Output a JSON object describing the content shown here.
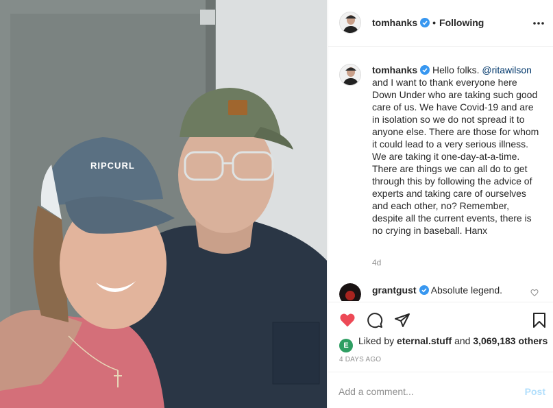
{
  "photo": {
    "icon": "selfie-photo",
    "cap_text": "RIPCURL"
  },
  "header": {
    "username": "tomhanks",
    "separator": "•",
    "follow_status": "Following",
    "more_icon": "more-icon"
  },
  "caption": {
    "username": "tomhanks",
    "text_before": "Hello folks. ",
    "mention": "@ritawilson",
    "text_after": " and I want to thank everyone here Down Under who are taking such good care of us. We have Covid-19 and are in isolation so we do not spread it to anyone else. There are those for whom it could lead to a very serious illness. We are taking it one-day-at-a-time. There are things we can all do to get through this by following the advice of experts and taking care of ourselves and each other, no? Remember, despite all the current events, there is no crying in baseball. Hanx",
    "age": "4d"
  },
  "comment": {
    "username": "grantgust",
    "text": "Absolute legend."
  },
  "likes": {
    "avatar_letter": "E",
    "prefix": "Liked by",
    "user": "eternal.stuff",
    "connector": "and",
    "count": "3,069,183 others"
  },
  "date": "4 DAYS AGO",
  "add_comment": {
    "placeholder": "Add a comment...",
    "post_label": "Post"
  },
  "colors": {
    "like_red": "#ed4956",
    "verified_blue": "#3897f0",
    "mention_blue": "#00376b",
    "post_disabled": "#b2dffc"
  }
}
